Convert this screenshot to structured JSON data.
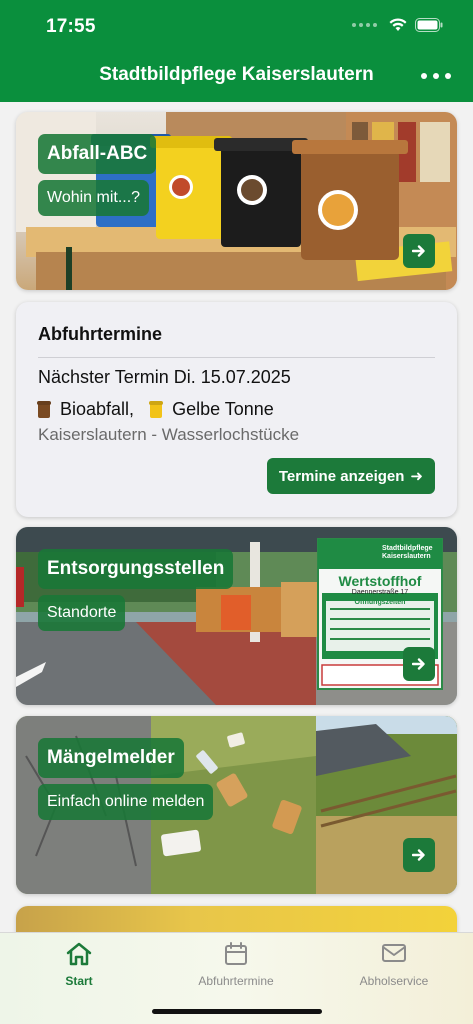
{
  "status": {
    "time": "17:55"
  },
  "nav": {
    "title": "Stadtbildpflege Kaiserslautern",
    "more_icon": "more-horizontal-icon"
  },
  "tiles": {
    "abfall": {
      "title": "Abfall-ABC",
      "subtitle": "Wohin mit...?"
    },
    "entsorgung": {
      "title": "Entsorgungsstellen",
      "subtitle": "Standorte",
      "sign_heading": "Stadtbildpflege Kaiserslautern",
      "sign_title": "Wertstoffhof",
      "sign_street": "Daennerstraße 17",
      "sign_hours_label": "Öffnungszeiten"
    },
    "maengel": {
      "title": "Mängelmelder",
      "subtitle": "Einfach online melden"
    }
  },
  "abfuhr": {
    "title": "Abfuhrtermine",
    "next": "Nächster Termin Di. 15.07.2025",
    "waste_types": [
      {
        "label": "Bioabfall,",
        "color": "#7a4a22"
      },
      {
        "label": "Gelbe Tonne",
        "color": "#f2c318"
      }
    ],
    "location": "Kaiserslautern - Wasserlochstücke",
    "button_label": "Termine anzeigen",
    "button_arrow": "➜"
  },
  "tabbar": {
    "items": [
      {
        "label": "Start",
        "icon": "home-icon",
        "active": true
      },
      {
        "label": "Abfuhrtermine",
        "icon": "calendar-icon",
        "active": false
      },
      {
        "label": "Abholservice",
        "icon": "mail-icon",
        "active": false
      }
    ]
  },
  "colors": {
    "brand": "#0a8f3d",
    "button": "#1c7a3a"
  }
}
